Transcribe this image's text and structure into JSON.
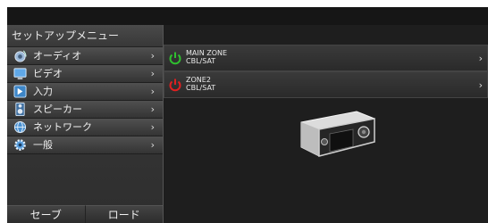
{
  "sidebar": {
    "title": "セットアップメニュー",
    "items": [
      {
        "label": "オーディオ",
        "icon": "speaker-sound-icon"
      },
      {
        "label": "ビデオ",
        "icon": "monitor-icon"
      },
      {
        "label": "入力",
        "icon": "input-icon"
      },
      {
        "label": "スピーカー",
        "icon": "speaker-icon"
      },
      {
        "label": "ネットワーク",
        "icon": "globe-icon"
      },
      {
        "label": "一般",
        "icon": "gear-icon"
      }
    ],
    "chevron": "›",
    "save_label": "セーブ",
    "load_label": "ロード"
  },
  "zones": [
    {
      "name": "MAIN ZONE",
      "source": "CBL/SAT",
      "power_color": "#2fbf2f"
    },
    {
      "name": "ZONE2",
      "source": "CBL/SAT",
      "power_color": "#e02020"
    }
  ],
  "colors": {
    "main_power": "#2fbf2f",
    "zone2_power": "#e02020"
  }
}
